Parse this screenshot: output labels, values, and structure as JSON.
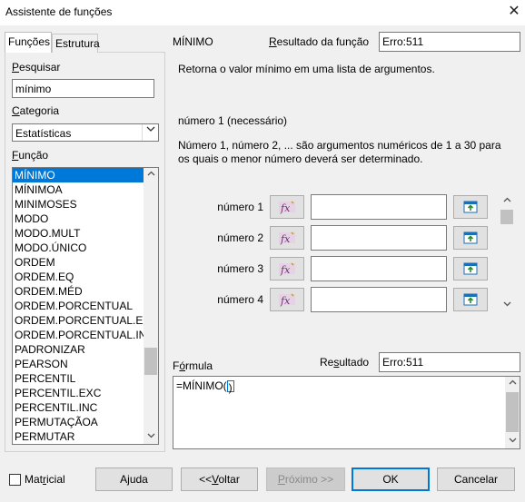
{
  "window": {
    "title": "Assistente de funções",
    "close_glyph": "✕"
  },
  "tabs": [
    {
      "label": "Funções",
      "active": true
    },
    {
      "label": "Estrutura",
      "active": false
    }
  ],
  "left": {
    "search_label": "Pesquisar",
    "search_value": "mínimo",
    "category_label": "Categoria",
    "category_value": "Estatísticas",
    "function_label": "Função",
    "functions": [
      "MÍNIMO",
      "MÍNIMOA",
      "MINIMOSES",
      "MODO",
      "MODO.MULT",
      "MODO.ÚNICO",
      "ORDEM",
      "ORDEM.EQ",
      "ORDEM.MÉD",
      "ORDEM.PORCENTUAL",
      "ORDEM.PORCENTUAL.EXC",
      "ORDEM.PORCENTUAL.INC",
      "PADRONIZAR",
      "PEARSON",
      "PERCENTIL",
      "PERCENTIL.EXC",
      "PERCENTIL.INC",
      "PERMUTAÇÃOA",
      "PERMUTAR"
    ],
    "selected_index": 0
  },
  "right": {
    "function_name": "MÍNIMO",
    "result_label": "Resultado da função",
    "result_value": "Erro:511",
    "description": "Retorna o valor mínimo em uma lista de argumentos.",
    "arg_title": "número 1 (necessário)",
    "arg_description": "Número 1, número 2, ... são argumentos numéricos de 1 a 30 para os quais o menor número deverá ser determinado.",
    "args": [
      {
        "label": "número 1",
        "value": ""
      },
      {
        "label": "número 2",
        "value": ""
      },
      {
        "label": "número 3",
        "value": ""
      },
      {
        "label": "número 4",
        "value": ""
      }
    ],
    "formula_label": "Fórmula",
    "formula_result_label": "Resultado",
    "formula_result_value": "Erro:511",
    "formula_before": "=MÍNIMO(",
    "formula_cursor": ")"
  },
  "footer": {
    "matricial_label": "Matricial",
    "help": "Ajuda",
    "back": "<<Voltar",
    "next": "Próximo >>",
    "ok": "OK",
    "cancel": "Cancelar"
  },
  "colors": {
    "selection": "#0078d7",
    "default_button_border": "#0078d7"
  }
}
